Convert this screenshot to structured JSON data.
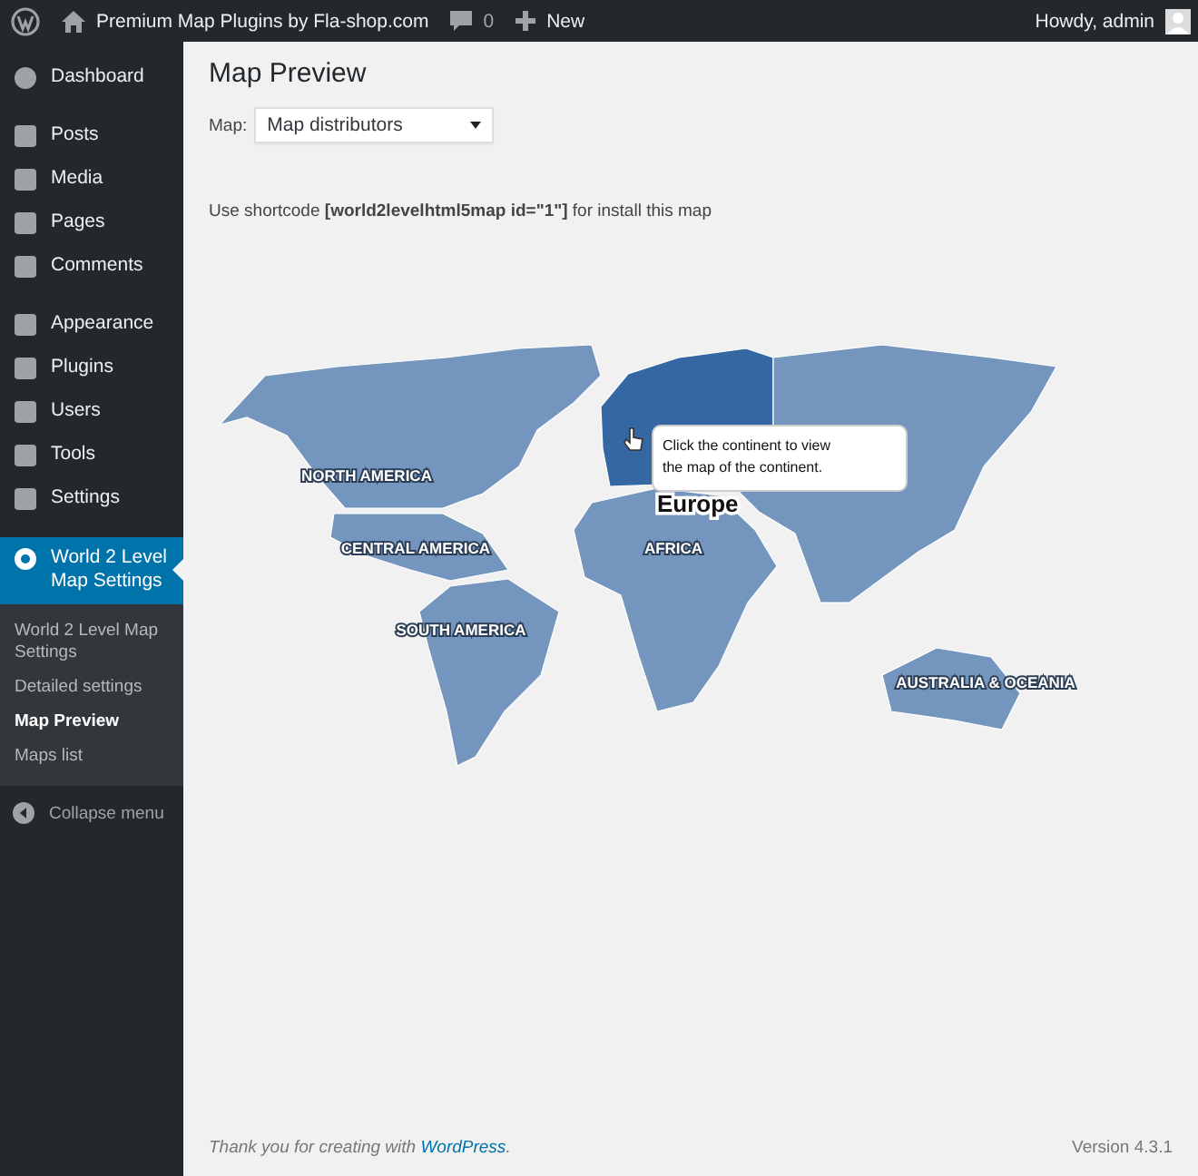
{
  "admin_bar": {
    "site_name": "Premium Map Plugins by Fla-shop.com",
    "comments_count": "0",
    "new_label": "New",
    "greeting": "Howdy, admin"
  },
  "sidebar": {
    "items": [
      {
        "label": "Dashboard",
        "selected": false
      },
      {
        "label": "Posts",
        "selected": false
      },
      {
        "label": "Media",
        "selected": false
      },
      {
        "label": "Pages",
        "selected": false
      },
      {
        "label": "Comments",
        "selected": false
      },
      {
        "label": "Appearance",
        "selected": false
      },
      {
        "label": "Plugins",
        "selected": false
      },
      {
        "label": "Users",
        "selected": false
      },
      {
        "label": "Tools",
        "selected": false
      },
      {
        "label": "Settings",
        "selected": false
      },
      {
        "label": "World 2 Level Map Settings",
        "selected": true
      }
    ],
    "submenu": [
      {
        "label": "World 2 Level Map Settings",
        "selected": false
      },
      {
        "label": "Detailed settings",
        "selected": false
      },
      {
        "label": "Map Preview",
        "selected": true
      },
      {
        "label": "Maps list",
        "selected": false
      }
    ],
    "collapse_label": "Collapse menu"
  },
  "page": {
    "title": "Map Preview",
    "map_label": "Map:",
    "map_select": "Map distributors",
    "shortcode_note": "Use shortcode **[world2levelhtml5map id=\"1\"]** for install this map"
  },
  "map": {
    "regions": [
      {
        "label": "NORTH AMERICA",
        "highlighted": false
      },
      {
        "label": "CENTRAL AMERICA",
        "highlighted": false
      },
      {
        "label": "SOUTH AMERICA",
        "highlighted": false
      },
      {
        "highlighted": true
      },
      {
        "highlighted": false
      },
      {
        "label": "AFRICA",
        "highlighted": false
      },
      {
        "label": "AUSTRALIA & OCEANIA",
        "highlighted": false
      }
    ],
    "hover_label": "Europe",
    "tooltip": [
      "Click the continent to view",
      "the map of the continent."
    ]
  },
  "footer": {
    "thanks": "Thank you for creating with",
    "link": "WordPress",
    "after": ".",
    "version": "Version 4.3.1"
  }
}
